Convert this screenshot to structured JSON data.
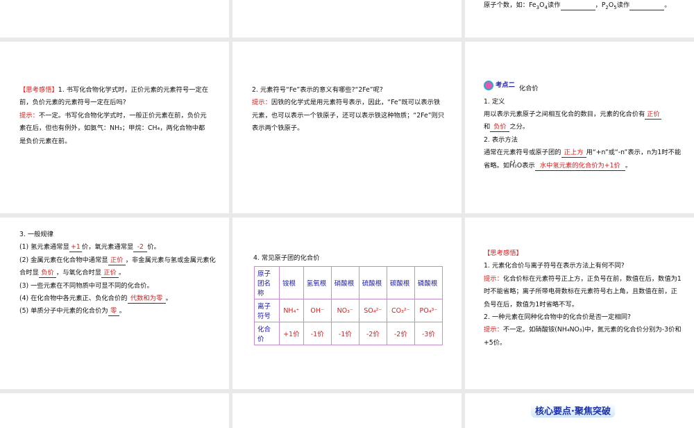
{
  "slides": {
    "top_right": {
      "prefix": "原子个数，如：Fe",
      "sub1": "3",
      "mid": "O",
      "sub2": "4",
      "read1": "读作",
      "sep": "，P",
      "sub3": "2",
      "o2": "O",
      "sub4": "5",
      "read2": "读作",
      "end": "。"
    },
    "s1": {
      "tag": "【思考感悟】",
      "q": "1. 书写化合物化学式时，正价元素的元素符号一定在前，负价元素的元素符号一定在后吗?",
      "hint_label": "提示：",
      "hint": "不一定。书写化合物化学式时，一般正价元素在前，负价元素在后，但也有例外，如氨气：NH₃；甲烷：CH₄，两化合物中都是负价元素在前。"
    },
    "s2": {
      "q": "2. 元素符号“Fe”表示的意义有哪些?“2Fe”呢?",
      "hint_label": "提示：",
      "hint": "因铁的化学式是用元素符号表示，因此，“Fe”既可以表示铁元素，也可以表示一个铁原子，还可以表示铁这种物质；“2Fe”则只表示两个铁原子。"
    },
    "s3": {
      "badge": "考点二",
      "title": "化合价",
      "h1": "1. 定义",
      "def_a": "用以表示元素原子之间相互化合的数目，元素的化合价有",
      "ans1": "正价",
      "and": "和",
      "ans2": "负价",
      "def_b": "之分。",
      "h2": "2. 表示方法",
      "m_a": "通常在元素符号或原子团的",
      "ans3": "正上方",
      "m_b": "用“+n”或“-n”表示，n为1时不能省略。如",
      "h2o": "H₂O",
      "plus1": "+1",
      "m_c": "表示",
      "ans4": "水中氢元素的化合价为+1价",
      "m_d": "。"
    },
    "s4": {
      "h": "3. 一般规律",
      "l1a": "(1) 氢元素通常显",
      "a1": "+1",
      "l1b": "价，氧元素通常显",
      "a2": "-2",
      "l1c": "价。",
      "l2a": "(2) 金属元素在化合物中通常显",
      "a3": "正价",
      "l2b": "，非金属元素与氢或金属元素化合时显",
      "a4": "负价",
      "l2c": "，与氧化合时显",
      "a5": "正价",
      "l2d": "。",
      "l3": "(3) 一些元素在不同物质中可显不同的化合价。",
      "l4a": "(4) 在化合物中各元素正、负化合价的",
      "a6": "代数和为零",
      "l4b": "。",
      "l5a": "(5) 单质分子中元素的化合价为",
      "a7": "零",
      "l5b": "。"
    },
    "s5": {
      "h": "4. 常见原子团的化合价",
      "rows": [
        [
          "原子团名称",
          "铵根",
          "氢氧根",
          "硝酸根",
          "硫酸根",
          "碳酸根",
          "磷酸根"
        ],
        [
          "离子符号",
          "NH₄⁺",
          "OH⁻",
          "NO₃⁻",
          "SO₄²⁻",
          "CO₃²⁻",
          "PO₄³⁻"
        ],
        [
          "化合价",
          "+1价",
          "-1价",
          "-1价",
          "-2价",
          "-2价",
          "-3价"
        ]
      ]
    },
    "s6": {
      "tag": "【思考感悟】",
      "q1": "1. 元素化合价与离子符号在表示方法上有何不同?",
      "hint_label": "提示：",
      "h1": "化合价标在元素符号正上方，正负号在前，数值在后，数值为1时不能省略；离子所带电荷数标在元素符号右上角，且数值在前，正负号在后，数值为1时省略不写。",
      "q2": "2. 一种元素在同种化合物中的化合价是否一定相同?",
      "h2": "不一定。如硝酸铵(NH₄NO₃)中，氮元素的化合价分别为-3价和+5价。"
    },
    "s9": {
      "banner": "核心要点·聚焦突破"
    }
  }
}
